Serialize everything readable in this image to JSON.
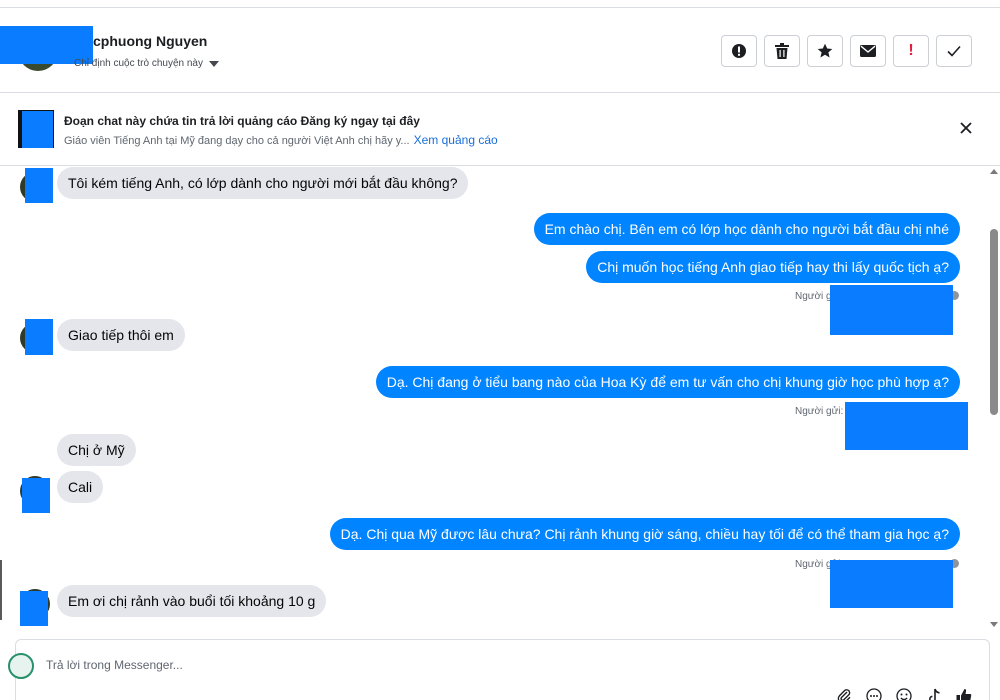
{
  "header": {
    "contact_name": "cphuong Nguyen",
    "assign_label": "Chỉ định cuộc trò chuyện này",
    "actions": [
      {
        "name": "alert-action-button",
        "icon": "alert-circle-icon"
      },
      {
        "name": "delete-action-button",
        "icon": "trash-icon"
      },
      {
        "name": "star-action-button",
        "icon": "star-icon"
      },
      {
        "name": "mail-action-button",
        "icon": "mail-icon"
      },
      {
        "name": "spam-action-button",
        "icon": "exclamation-icon",
        "label": "!"
      },
      {
        "name": "done-action-button",
        "icon": "check-icon"
      }
    ]
  },
  "banner": {
    "title": "Đoạn chat này chứa tin trả lời quảng cáo Đăng ký ngay tại đây",
    "subtitle": "Giáo viên Tiếng Anh tại Mỹ đang dạy cho cả người Việt Anh chị hãy y...",
    "link": "Xem quảng cáo"
  },
  "messages": [
    {
      "dir": "in",
      "text": "Tôi kém tiếng Anh, có lớp dành cho người mới bắt đầu không?"
    },
    {
      "dir": "out",
      "text": "Em chào chị. Bên em có lớp học dành cho người bắt đầu chị nhé"
    },
    {
      "dir": "out",
      "text": "Chị muốn học tiếng Anh giao tiếp hay thi lấy quốc tịch ạ?"
    },
    {
      "dir": "in",
      "text": "Giao tiếp thôi em"
    },
    {
      "dir": "out",
      "text": "Dạ. Chị đang ở tiểu bang nào của Hoa Kỳ để em tư vấn cho chị khung giờ học phù hợp ạ?"
    },
    {
      "dir": "in",
      "text": "Chị ở Mỹ"
    },
    {
      "dir": "in",
      "text": "Cali"
    },
    {
      "dir": "out",
      "text": "Dạ. Chị qua Mỹ được lâu chưa? Chị rảnh khung giờ sáng, chiều hay tối để có thể tham gia học ạ?"
    },
    {
      "dir": "in",
      "text": "Em ơi chị rảnh vào buổi tối khoảng 10 g"
    }
  ],
  "sender_labels": [
    "Người gửi:",
    "Người gửi:",
    "Người gửi:"
  ],
  "composer": {
    "placeholder": "Trả lời trong Messenger...",
    "tools": [
      "paperclip-icon",
      "emoji-icon",
      "smiley-icon",
      "tiktok-icon",
      "like-icon"
    ]
  },
  "colors": {
    "outgoing_bubble": "#0084ff",
    "incoming_bubble": "#e4e6eb",
    "redaction": "#0a7cff"
  }
}
